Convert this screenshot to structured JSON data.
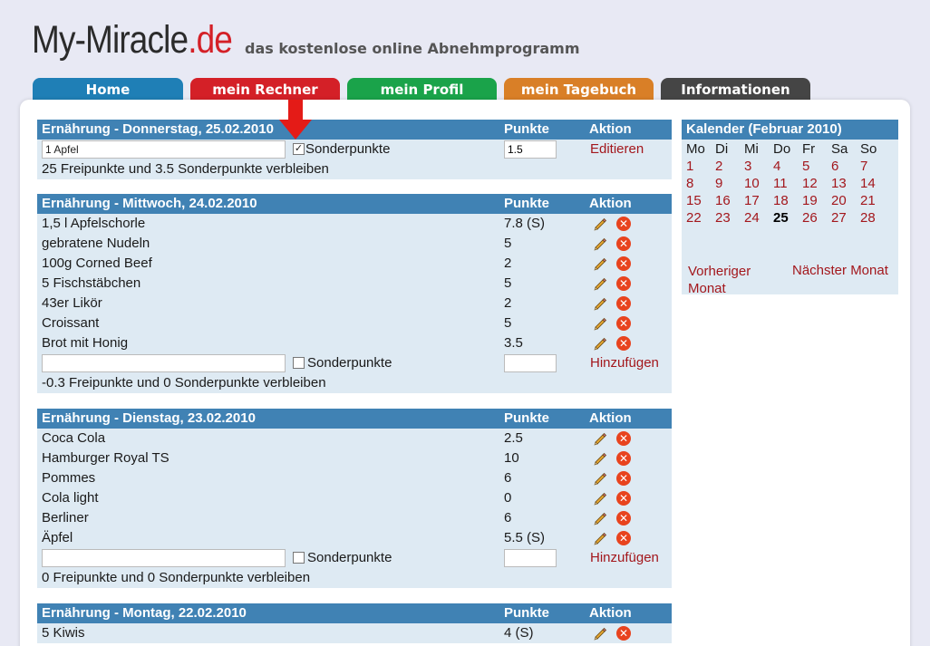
{
  "header": {
    "logo_main": "My-Miracle",
    "logo_tld": ".de",
    "slogan": "das kostenlose online Abnehmprogramm"
  },
  "nav": {
    "tabs": [
      {
        "label": "Home",
        "color": "#1f7fb6"
      },
      {
        "label": "mein Rechner",
        "color": "#d42027"
      },
      {
        "label": "mein Profil",
        "color": "#1aa34a"
      },
      {
        "label": "mein Tagebuch",
        "color": "#d97f27"
      },
      {
        "label": "Informationen",
        "color": "#454545"
      }
    ]
  },
  "columns": {
    "points": "Punkte",
    "action": "Aktion"
  },
  "today": {
    "title": "Ernährung - Donnerstag, 25.02.2010",
    "food_value": "1 Apfel",
    "special_checked": true,
    "special_label": "Sonderpunkte",
    "points_value": "1.5",
    "action_label": "Editieren",
    "footer": "25 Freipunkte und 3.5 Sonderpunkte verbleiben"
  },
  "days": [
    {
      "title": "Ernährung - Mittwoch, 24.02.2010",
      "entries": [
        {
          "food": "1,5 l Apfelschorle",
          "points": "7.8 (S)"
        },
        {
          "food": "gebratene Nudeln",
          "points": "5"
        },
        {
          "food": "100g Corned Beef",
          "points": "2"
        },
        {
          "food": "5 Fischstäbchen",
          "points": "5"
        },
        {
          "food": "43er Likör",
          "points": "2"
        },
        {
          "food": "Croissant",
          "points": "5"
        },
        {
          "food": "Brot mit Honig",
          "points": "3.5"
        }
      ],
      "special_label": "Sonderpunkte",
      "add_label": "Hinzufügen",
      "footer": "-0.3 Freipunkte und 0 Sonderpunkte verbleiben"
    },
    {
      "title": "Ernährung - Dienstag, 23.02.2010",
      "entries": [
        {
          "food": "Coca Cola",
          "points": "2.5"
        },
        {
          "food": "Hamburger Royal TS",
          "points": "10"
        },
        {
          "food": "Pommes",
          "points": "6"
        },
        {
          "food": "Cola light",
          "points": "0"
        },
        {
          "food": "Berliner",
          "points": "6"
        },
        {
          "food": "Äpfel",
          "points": "5.5 (S)"
        }
      ],
      "special_label": "Sonderpunkte",
      "add_label": "Hinzufügen",
      "footer": "0 Freipunkte und 0 Sonderpunkte verbleiben"
    },
    {
      "title": "Ernährung - Montag, 22.02.2010",
      "entries": [
        {
          "food": "5 Kiwis",
          "points": "4 (S)"
        }
      ]
    }
  ],
  "calendar": {
    "title": "Kalender (Februar 2010)",
    "weekdays": [
      "Mo",
      "Di",
      "Mi",
      "Do",
      "Fr",
      "Sa",
      "So"
    ],
    "weeks": [
      [
        "1",
        "2",
        "3",
        "4",
        "5",
        "6",
        "7"
      ],
      [
        "8",
        "9",
        "10",
        "11",
        "12",
        "13",
        "14"
      ],
      [
        "15",
        "16",
        "17",
        "18",
        "19",
        "20",
        "21"
      ],
      [
        "22",
        "23",
        "24",
        "25",
        "26",
        "27",
        "28"
      ]
    ],
    "today": "25",
    "prev_label": "Vorheriger Monat",
    "next_label": "Nächster Monat"
  },
  "colors": {
    "header_blue": "#4082b4",
    "row_bg": "#deeaf3",
    "link_red": "#a3171c",
    "delete_red": "#e8431e"
  },
  "icons": {
    "edit": "pencil-icon",
    "delete": "delete-icon",
    "annotation": "red-arrow-icon"
  }
}
